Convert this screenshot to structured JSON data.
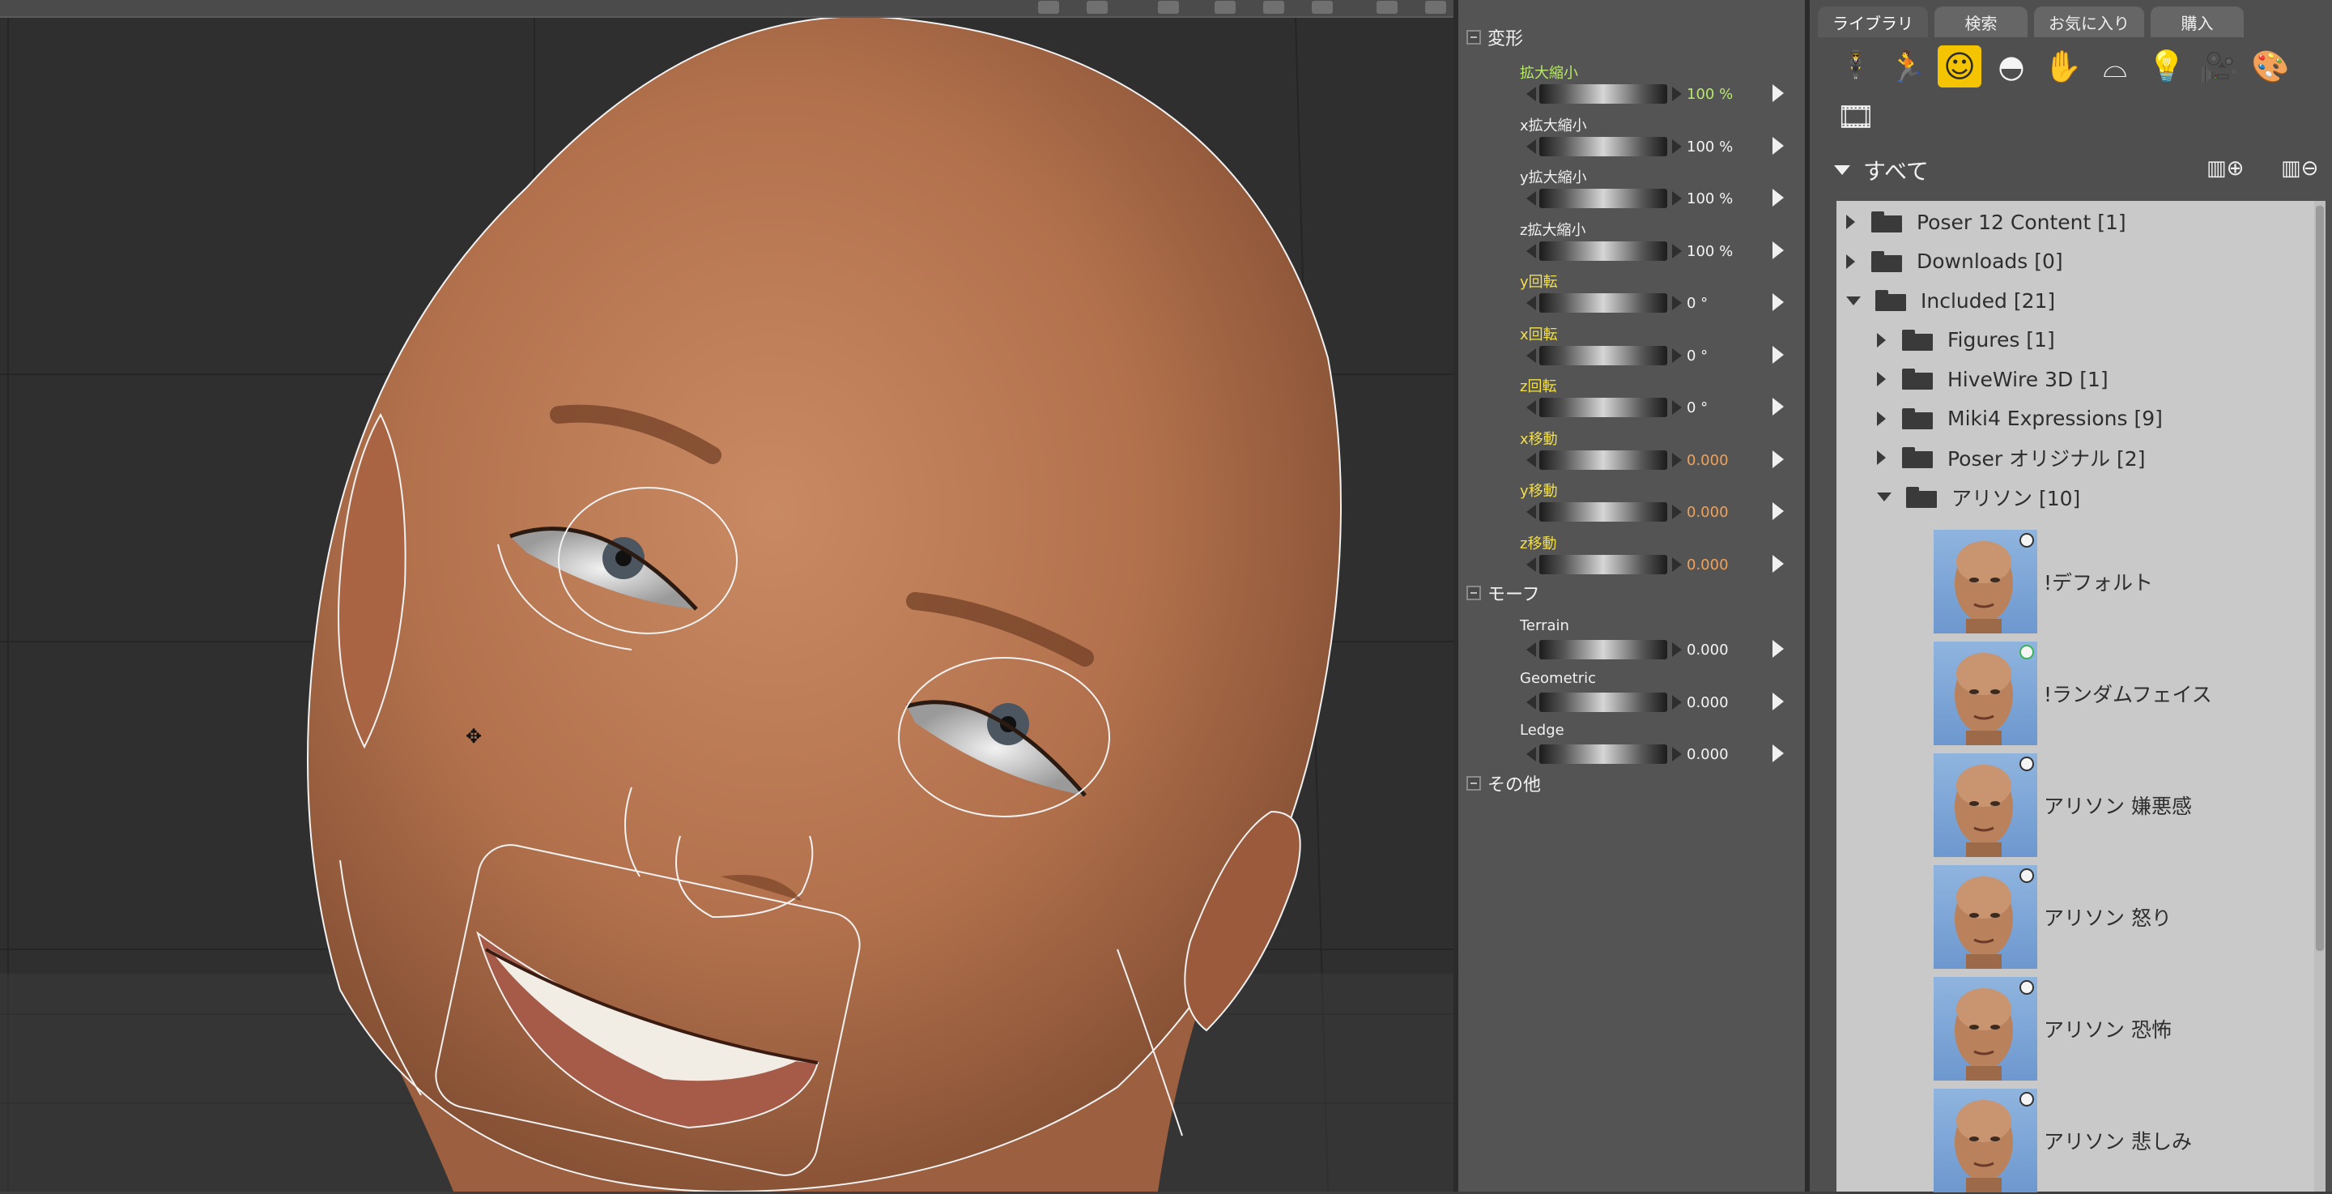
{
  "params": {
    "groups": [
      {
        "label": "変形"
      },
      {
        "label": "モーフ"
      },
      {
        "label": "その他"
      }
    ],
    "transform": [
      {
        "label": "拡大縮小",
        "value": "100 %",
        "label_color": "green",
        "value_color": "green"
      },
      {
        "label": "x拡大縮小",
        "value": "100 %",
        "label_color": "white",
        "value_color": "white"
      },
      {
        "label": "y拡大縮小",
        "value": "100 %",
        "label_color": "white",
        "value_color": "white"
      },
      {
        "label": "z拡大縮小",
        "value": "100 %",
        "label_color": "white",
        "value_color": "white"
      },
      {
        "label": "y回転",
        "value": "0 °",
        "label_color": "yellow",
        "value_color": "white"
      },
      {
        "label": "x回転",
        "value": "0 °",
        "label_color": "yellow",
        "value_color": "white"
      },
      {
        "label": "z回転",
        "value": "0 °",
        "label_color": "yellow",
        "value_color": "white"
      },
      {
        "label": "x移動",
        "value": "0.000",
        "label_color": "orange",
        "value_color": "orange"
      },
      {
        "label": "y移動",
        "value": "0.000",
        "label_color": "orange",
        "value_color": "orange"
      },
      {
        "label": "z移動",
        "value": "0.000",
        "label_color": "orange",
        "value_color": "orange"
      }
    ],
    "morph": [
      {
        "label": "Terrain",
        "value": "0.000"
      },
      {
        "label": "Geometric",
        "value": "0.000"
      },
      {
        "label": "Ledge",
        "value": "0.000"
      }
    ]
  },
  "library": {
    "tabs": [
      "ライブラリ",
      "検索",
      "お気に入り",
      "購入"
    ],
    "active_tab": "ライブラリ",
    "category_icons": [
      "figure-icon",
      "pose-icon",
      "expression-icon",
      "hair-icon",
      "hand-icon",
      "props-icon",
      "light-icon",
      "camera-icon",
      "material-icon",
      "scene-icon"
    ],
    "selected_category": "expression-icon",
    "filter_label": "すべて",
    "tree": [
      {
        "label": "Poser 12 Content [1]",
        "level": 0,
        "expanded": false
      },
      {
        "label": "Downloads [0]",
        "level": 0,
        "expanded": false
      },
      {
        "label": "Included [21]",
        "level": 0,
        "expanded": true
      },
      {
        "label": "Figures [1]",
        "level": 1,
        "expanded": false
      },
      {
        "label": "HiveWire 3D [1]",
        "level": 1,
        "expanded": false
      },
      {
        "label": "Miki4 Expressions [9]",
        "level": 1,
        "expanded": false
      },
      {
        "label": "Poser オリジナル [2]",
        "level": 1,
        "expanded": false
      },
      {
        "label": "アリソン [10]",
        "level": 1,
        "expanded": true
      }
    ],
    "items": [
      {
        "label": "!デフォルト",
        "badge": "white"
      },
      {
        "label": "!ランダムフェイス",
        "badge": "green"
      },
      {
        "label": "アリソン 嫌悪感",
        "badge": "white"
      },
      {
        "label": "アリソン 怒り",
        "badge": "white"
      },
      {
        "label": "アリソン 恐怖",
        "badge": "white"
      },
      {
        "label": "アリソン 悲しみ",
        "badge": "white"
      }
    ]
  }
}
